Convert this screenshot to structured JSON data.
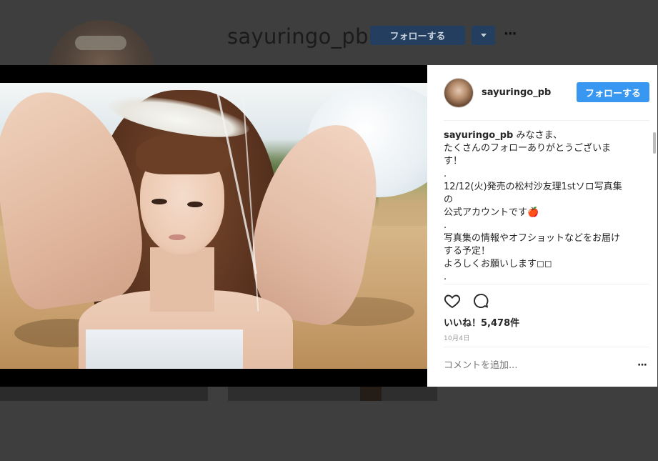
{
  "background": {
    "username": "sayuringo_pb",
    "follow_label": "フォローする",
    "more_label": "···"
  },
  "post": {
    "username": "sayuringo_pb",
    "follow_label": "フォローする",
    "caption_username": "sayuringo_pb",
    "caption_text": " みなさま、\nたくさんのフォローありがとうございま\nす！\n.\n12/12(火)発売の松村沙友理1stソロ写真集\nの\n公式アカウントです🍎\n.\n写真集の情報やオフショットなどをお届け\nする予定！\nよろしくお願いします◻◻\n.",
    "likes_label": "いいね！5,478件",
    "date": "10月4日",
    "comment_placeholder": "コメントを追加...",
    "more_label": "···"
  },
  "colors": {
    "follow_button": "#3897f0",
    "overlay_button": "#243e5f"
  },
  "icons": [
    "heart-icon",
    "comment-icon",
    "chevron-down-icon",
    "more-icon"
  ]
}
